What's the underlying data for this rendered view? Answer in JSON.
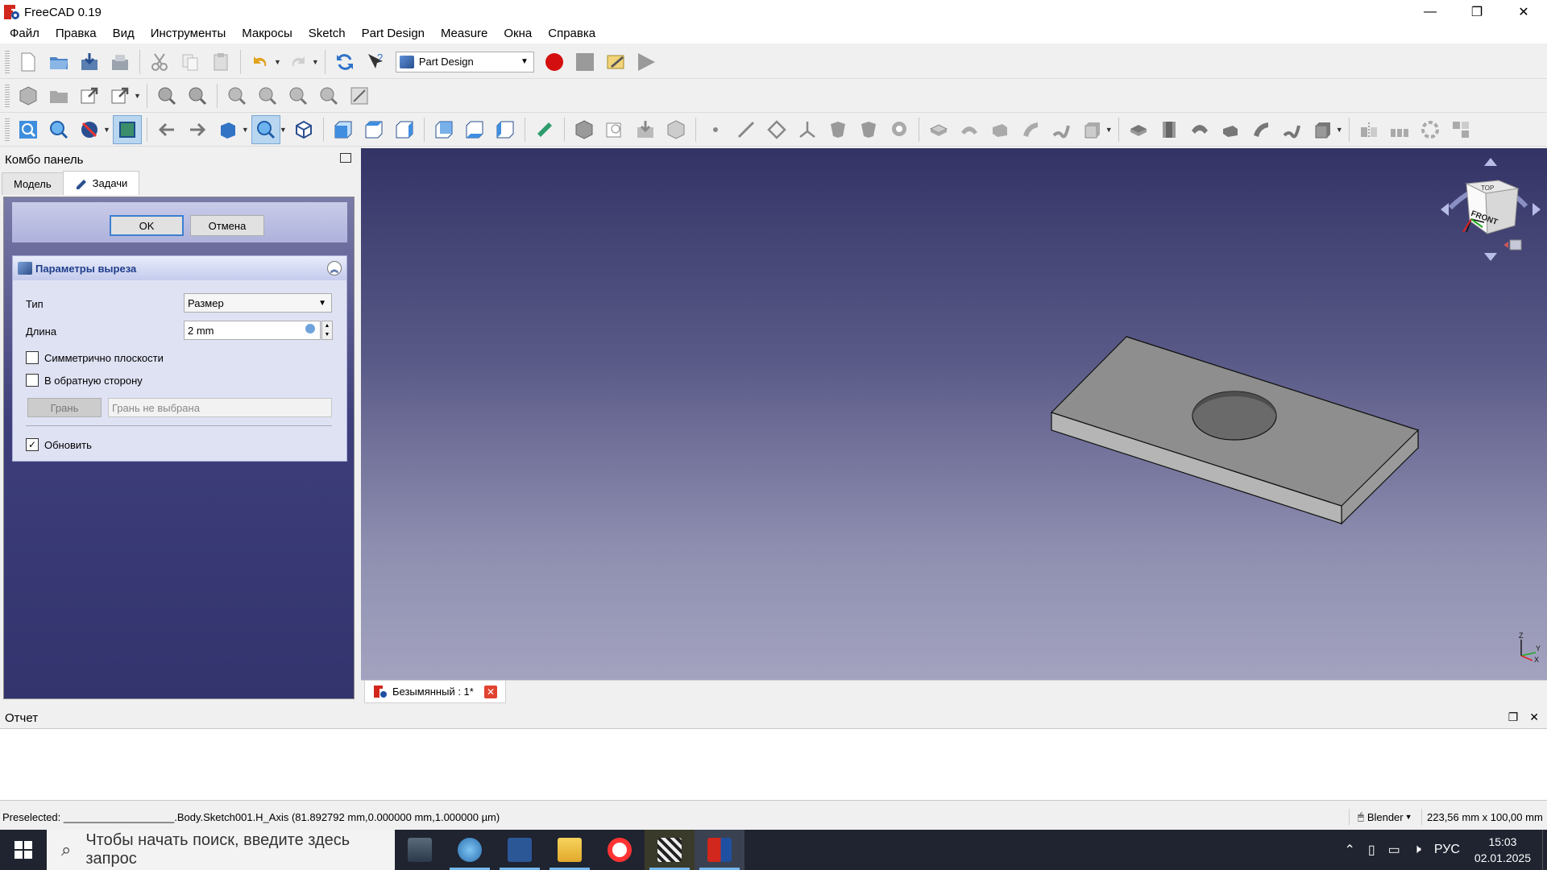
{
  "window": {
    "title": "FreeCAD 0.19",
    "min": "—",
    "max": "❐",
    "close": "✕"
  },
  "menu": [
    "Файл",
    "Правка",
    "Вид",
    "Инструменты",
    "Макросы",
    "Sketch",
    "Part Design",
    "Measure",
    "Окна",
    "Справка"
  ],
  "workbench": {
    "selected": "Part Design"
  },
  "combo": {
    "title": "Комбо панель",
    "tabs": {
      "model": "Модель",
      "tasks": "Задачи"
    },
    "ok": "OK",
    "cancel": "Отмена",
    "params": {
      "title": "Параметры выреза",
      "type_label": "Тип",
      "type_value": "Размер",
      "length_label": "Длина",
      "length_value": "2 mm",
      "symmetric_label": "Симметрично плоскости",
      "symmetric_checked": false,
      "reversed_label": "В обратную сторону",
      "reversed_checked": false,
      "face_button": "Грань",
      "face_placeholder": "Грань не выбрана",
      "update_label": "Обновить",
      "update_checked": true
    }
  },
  "viewport": {
    "background_top": "#333366",
    "background_bottom": "#a3a3c0",
    "navcube_faces": {
      "front": "FRONT",
      "top": "TOP"
    },
    "axis_labels": {
      "z": "Z",
      "y": "Y",
      "x": "X"
    }
  },
  "doc_tab": {
    "label": "Безымянный : 1*"
  },
  "report": {
    "title": "Отчет"
  },
  "status": {
    "preselected": "Preselected: ___________________.Body.Sketch001.H_Axis (81.892792 mm,0.000000 mm,1.000000 µm)",
    "nav_style": "Blender",
    "dimensions": "223,56 mm x 100,00 mm"
  },
  "taskbar": {
    "search_placeholder": "Чтобы начать поиск, введите здесь запрос",
    "lang": "РУС",
    "time": "15:03",
    "date": "02.01.2025"
  }
}
